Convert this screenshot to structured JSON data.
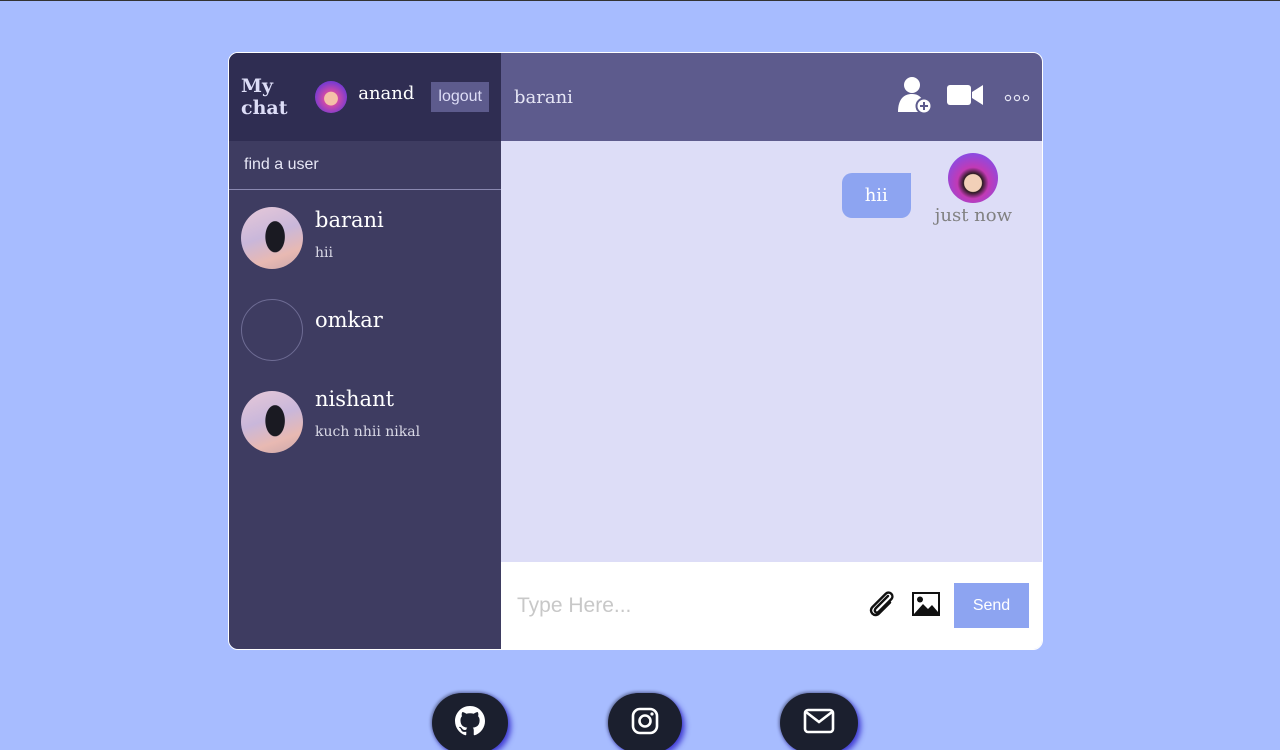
{
  "sidebar": {
    "logo": "My chat",
    "user_name": "anand",
    "logout_label": "logout",
    "search_placeholder": "find a user",
    "chats": [
      {
        "name": "barani",
        "last_message": "hii"
      },
      {
        "name": "omkar",
        "last_message": ""
      },
      {
        "name": "nishant",
        "last_message": "kuch nhii nikal"
      }
    ]
  },
  "chat": {
    "title": "barani",
    "icons": [
      "add-user-icon",
      "video-camera-icon",
      "more-options-icon"
    ],
    "messages": [
      {
        "text": "hii",
        "time": "just now",
        "owner": true
      }
    ],
    "input_placeholder": "Type Here...",
    "send_label": "Send",
    "input_icons": [
      "paperclip-icon",
      "image-icon"
    ]
  },
  "social": [
    "github-icon",
    "instagram-icon",
    "mail-icon"
  ],
  "colors": {
    "background": "#a7bcff",
    "sidebar": "#3e3c61",
    "navbar": "#2f2d52",
    "chat_header": "#5d5b8d",
    "messages_bg": "#ddddf7",
    "accent": "#8da4f1"
  }
}
